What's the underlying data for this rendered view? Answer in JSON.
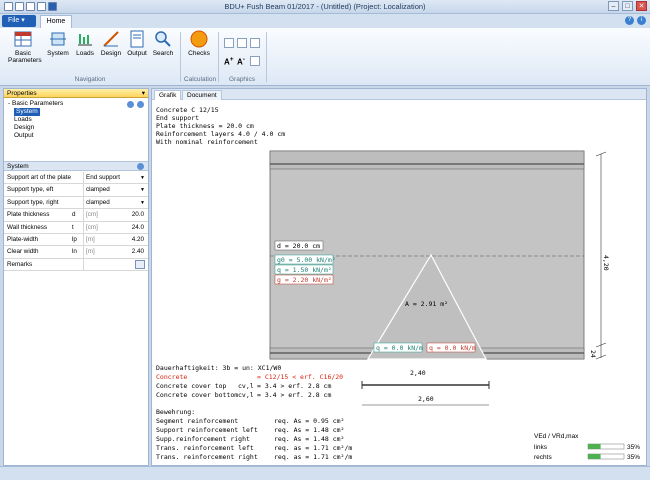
{
  "window": {
    "title": "BDU+ Fush Beam 01/2017 - (Untitled) (Project: Localization)"
  },
  "menu": {
    "file": "File",
    "home": "Home"
  },
  "ribbon": {
    "basic1": "Basic",
    "basic2": "Parameters",
    "system": "System",
    "loads": "Loads",
    "design": "Design",
    "output": "Output",
    "search": "Search",
    "checks": "Checks",
    "grp_nav": "Navigation",
    "grp_calc": "Calculation",
    "grp_graph": "Graphics"
  },
  "properties": {
    "header": "Properties",
    "items": [
      "Basic Parameters",
      "System",
      "Loads",
      "Design",
      "Output"
    ]
  },
  "system": {
    "header": "System",
    "rows": [
      {
        "label": "Support art of the plate",
        "sym": "",
        "unit": "",
        "value": "End support"
      },
      {
        "label": "Support type, eft",
        "sym": "",
        "unit": "",
        "value": "clamped"
      },
      {
        "label": "Support type, right",
        "sym": "",
        "unit": "",
        "value": "clamped"
      },
      {
        "label": "Plate thickness",
        "sym": "d",
        "unit": "[cm]",
        "value": "20.0"
      },
      {
        "label": "Wall thickness",
        "sym": "t",
        "unit": "[cm]",
        "value": "24.0"
      },
      {
        "label": "Plate-width",
        "sym": "lp",
        "unit": "[m]",
        "value": "4.20"
      },
      {
        "label": "Clear width",
        "sym": "ln",
        "unit": "[m]",
        "value": "2.40"
      },
      {
        "label": "Remarks",
        "sym": "",
        "unit": "",
        "value": ""
      }
    ]
  },
  "doc": {
    "tab1": "Grafik",
    "tab2": "Document"
  },
  "drawing": {
    "header": [
      "Concrete C 12/15",
      "End support",
      "Plate thickness = 20.0 cm",
      "Reinforcement layers 4.0 / 4.0 cm",
      "With nominal reinforcement"
    ],
    "d_label": "d = 20.0 cm",
    "g0": "g0 = 5.00 kN/m²",
    "q": "q = 1.50 kN/m²",
    "g": "g = 2.20 kN/m²",
    "area": "A = 2.91 m²",
    "load_left": "q = 0.0 kN/m",
    "load_right": "q = 0.0 kN/m",
    "dim_right": "4,20",
    "dim_small": "24",
    "dim_inner": "2,40",
    "dim_outer": "2,60",
    "durability": "Dauerhaftigkeit: 3b = un: XC1/W0",
    "conc_label": "Concrete",
    "conc_val": "= C12/15  < erf. C16/20",
    "cover_top": "Concrete cover top",
    "cover_top_sym": "cv,l",
    "cover_top_val": "=      3.4 > erf. 2.8 cm",
    "cover_bot": "Concrete cover bottom",
    "cover_bot_sym": "cv,l",
    "cover_bot_val": "=      3.4 > erf. 2.8 cm",
    "bew": "Bewehrung:",
    "rein": [
      {
        "l": "Segment reinforcement",
        "v": "req. As  =  0.95 cm²"
      },
      {
        "l": "Support reinforcement left",
        "v": "req. As  =  1.48 cm²"
      },
      {
        "l": "Supp.reinforcement right",
        "v": "req. As  =  1.48 cm²"
      },
      {
        "l": "Trans. reinforcement left",
        "v": "req. as  =  1.71 cm²/m"
      },
      {
        "l": "Trans. reinforcement right",
        "v": "req. as  =  1.71 cm²/m"
      }
    ],
    "ratio_title": "VEd / VRd,max",
    "ratio_left": "links",
    "ratio_left_val": "35%",
    "ratio_left_frac": 0.35,
    "ratio_right": "rechts",
    "ratio_right_val": "35%",
    "ratio_right_frac": 0.35
  }
}
